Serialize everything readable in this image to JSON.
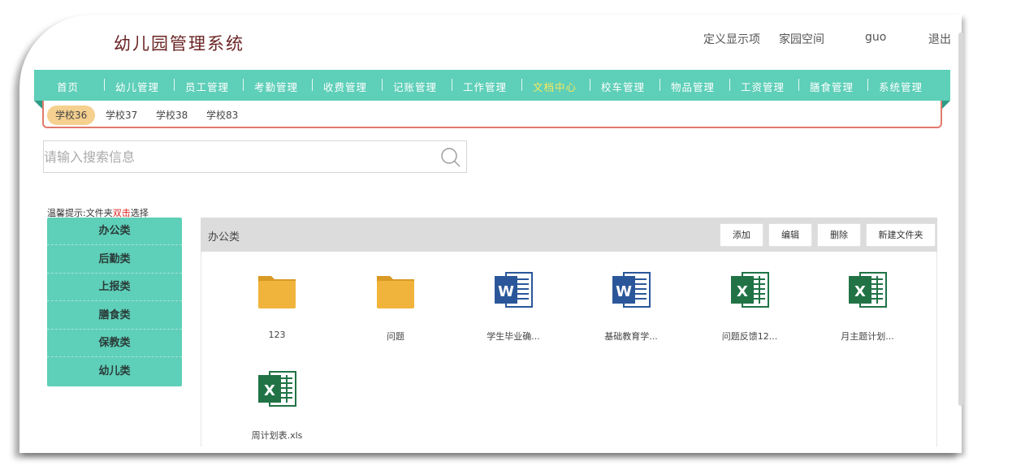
{
  "app": {
    "title": "幼儿园管理系统"
  },
  "top_links": {
    "display_items": "定义显示项",
    "home_space": "家园空间",
    "username": "guo",
    "logout": "退出"
  },
  "nav": [
    {
      "label": "首页",
      "active": false
    },
    {
      "label": "幼儿管理",
      "active": false
    },
    {
      "label": "员工管理",
      "active": false
    },
    {
      "label": "考勤管理",
      "active": false
    },
    {
      "label": "收费管理",
      "active": false
    },
    {
      "label": "记账管理",
      "active": false
    },
    {
      "label": "工作管理",
      "active": false
    },
    {
      "label": "文档中心",
      "active": true
    },
    {
      "label": "校车管理",
      "active": false
    },
    {
      "label": "物品管理",
      "active": false
    },
    {
      "label": "工资管理",
      "active": false
    },
    {
      "label": "膳食管理",
      "active": false
    },
    {
      "label": "系统管理",
      "active": false
    }
  ],
  "schools": [
    {
      "label": "学校36",
      "active": true
    },
    {
      "label": "学校37",
      "active": false
    },
    {
      "label": "学校38",
      "active": false
    },
    {
      "label": "学校83",
      "active": false
    }
  ],
  "search": {
    "placeholder": "请输入搜索信息"
  },
  "tip": {
    "prefix": "温馨提示:文件夹",
    "highlight": "双击",
    "suffix": "选择"
  },
  "categories": [
    "办公类",
    "后勤类",
    "上报类",
    "膳食类",
    "保教类",
    "幼儿类"
  ],
  "main": {
    "title": "办公类",
    "buttons": {
      "add": "添加",
      "edit": "编辑",
      "delete": "删除",
      "new_folder": "新建文件夹"
    }
  },
  "files": [
    {
      "name": "123",
      "type": "folder"
    },
    {
      "name": "问题",
      "type": "folder"
    },
    {
      "name": "学生毕业确...",
      "type": "word"
    },
    {
      "name": "基础教育学...",
      "type": "word"
    },
    {
      "name": "问题反馈12...",
      "type": "excel"
    },
    {
      "name": "月主题计划...",
      "type": "excel"
    },
    {
      "name": "周计划表.xls",
      "type": "excel"
    }
  ],
  "colors": {
    "nav_bg": "#5ecfb8",
    "nav_active": "#f7e85f",
    "school_active": "#f5d08e",
    "tip_highlight": "#e02020",
    "word": "#2b579a",
    "excel": "#217346",
    "folder": "#f0b43c"
  }
}
